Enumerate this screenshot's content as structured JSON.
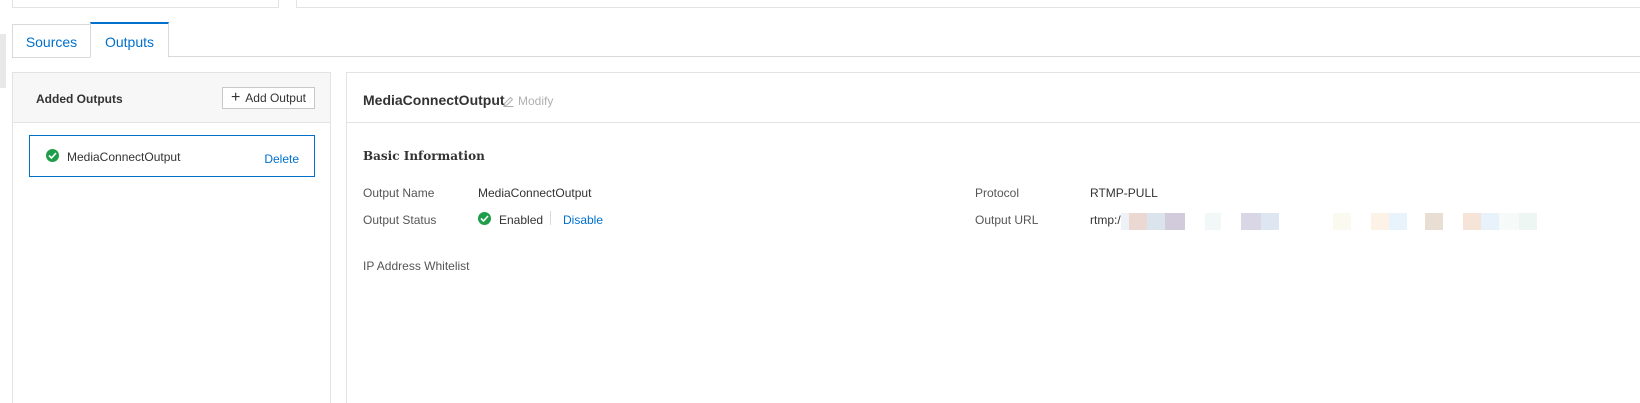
{
  "tabs": [
    {
      "label": "Sources"
    },
    {
      "label": "Outputs"
    }
  ],
  "left_panel": {
    "title": "Added Outputs",
    "add_button": "Add Output",
    "items": [
      {
        "name": "MediaConnectOutput",
        "delete_label": "Delete"
      }
    ]
  },
  "detail": {
    "title": "MediaConnectOutput",
    "modify_label": "Modify",
    "section_title": "Basic Information",
    "fields": {
      "output_name_label": "Output Name",
      "output_name_value": "MediaConnectOutput",
      "output_status_label": "Output Status",
      "output_status_value": "Enabled",
      "disable_label": "Disable",
      "protocol_label": "Protocol",
      "protocol_value": "RTMP-PULL",
      "output_url_label": "Output URL",
      "output_url_value": "rtmp:/",
      "ip_whitelist_label": "IP Address Whitelist"
    }
  },
  "colors": {
    "accent": "#0070cc",
    "success": "#1e9e4a",
    "border": "#e3e3e3"
  }
}
